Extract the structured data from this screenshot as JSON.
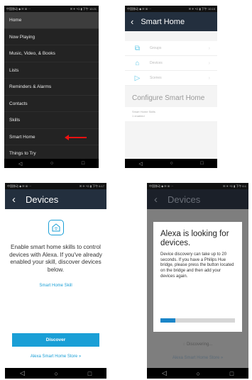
{
  "status": {
    "p1_left": "中国移动 ◆ ✉ ⊞ ···",
    "p1_right": "✉ ✈ ⁴G ▮ 下午 10:21",
    "p2_left": "中国移动 ◆ ✉ ⊞ ···",
    "p2_right": "✉ ✈ ⁴G ▮ 下午 10:15",
    "p3_left": "中国移动 ◆ ✉ ⊞ ···",
    "p3_right": "✉ ✈ ⁴G ▮ 下午 6:17",
    "p4_left": "中国移动 ◆ ✉ ⊞ ···",
    "p4_right": "✉ ✈ ⁴G ▮ 下午 6:1"
  },
  "nav": {
    "back": "◁",
    "home": "○",
    "recent": "□"
  },
  "menu": {
    "items": [
      {
        "label": "Home"
      },
      {
        "label": "Now Playing"
      },
      {
        "label": "Music, Video, & Books"
      },
      {
        "label": "Lists"
      },
      {
        "label": "Reminders & Alarms"
      },
      {
        "label": "Contacts"
      },
      {
        "label": "Skills"
      },
      {
        "label": "Smart Home"
      },
      {
        "label": "Things to Try"
      }
    ],
    "active_index": 0,
    "highlight_index": 7
  },
  "smart_home": {
    "back": "‹",
    "title": "Smart Home",
    "rows": [
      {
        "label": "Groups",
        "icon": "groups-icon"
      },
      {
        "label": "Devices",
        "icon": "devices-icon"
      },
      {
        "label": "Scenes",
        "icon": "scenes-icon"
      }
    ],
    "configure": "Configure Smart Home",
    "skills_title": "Smart Home Skills",
    "skills_count": "1 enabled"
  },
  "devices": {
    "back": "‹",
    "title": "Devices",
    "message": "Enable smart home skills to control devices with Alexa. If you've already enabled your skill, discover devices below.",
    "skill_link": "Smart Home Skill",
    "discover_button": "Discover",
    "store_link": "Alexa Smart Home Store »"
  },
  "dialog": {
    "title": "Alexa is looking for devices.",
    "body": "Device discovery can take up to 20 seconds. If you have a Philips Hue bridge, please press the button located on the bridge and then add your devices again.",
    "progress": 0.2,
    "discovering": "Discovering..."
  },
  "colors": {
    "accent": "#1a9fd6",
    "header": "#232f3e",
    "arrow": "#e11111"
  }
}
